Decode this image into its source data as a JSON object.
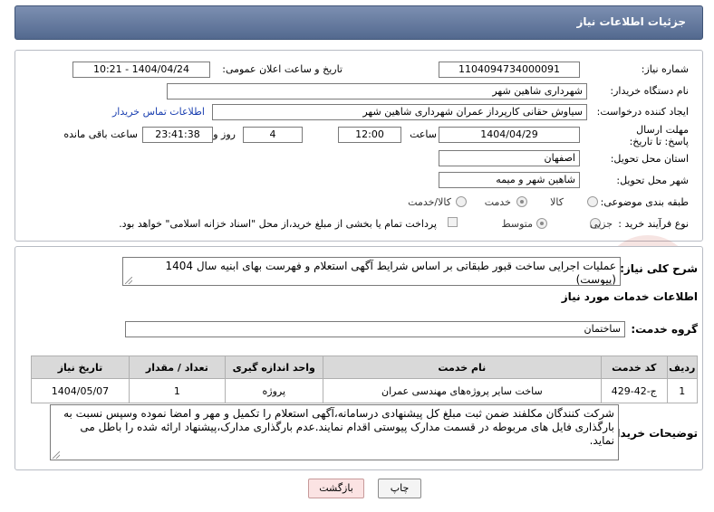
{
  "header": {
    "title": "جزئیات اطلاعات نیاز"
  },
  "fields": {
    "need_number_label": "شماره نیاز:",
    "need_number": "1104094734000091",
    "announce_label": "تاریخ و ساعت اعلان عمومی:",
    "announce_value": "1404/04/24 - 10:21",
    "buyer_label": "نام دستگاه خریدار:",
    "buyer": "شهرداری شاهین شهر",
    "creator_label": "ایجاد کننده درخواست:",
    "creator": "سیاوش حقانی کارپرداز عمران شهرداری شاهین شهر",
    "contact_link": "اطلاعات تماس خریدار",
    "deadline_label": "مهلت ارسال پاسخ: تا تاریخ:",
    "deadline_date": "1404/04/29",
    "time_label": "ساعت",
    "deadline_time": "12:00",
    "days_value": "4",
    "days_label": "روز و",
    "remaining_time": "23:41:38",
    "remaining_label": "ساعت باقی مانده",
    "province_label": "استان محل تحویل:",
    "province": "اصفهان",
    "city_label": "شهر محل تحویل:",
    "city": "شاهین شهر و میمه",
    "category_label": "طبقه بندی موضوعی:",
    "category_options": [
      "کالا",
      "خدمت",
      "کالا/خدمت"
    ],
    "purchase_label": "نوع فرآیند خرید :",
    "purchase_options": [
      "جزیی",
      "متوسط"
    ],
    "payment_note": "پرداخت تمام یا بخشی از مبلغ خرید،از محل \"اسناد خزانه اسلامی\" خواهد بود."
  },
  "summary": {
    "label": "شرح کلی نیاز:",
    "text": "عملیات اجرایی ساخت قبور طبقاتی بر اساس شرایط آگهی استعلام و فهرست بهای ابنیه سال 1404 (پیوست)"
  },
  "services": {
    "section_title": "اطلاعات خدمات مورد نیاز",
    "group_label": "گروه خدمت:",
    "group_value": "ساختمان",
    "columns": [
      "ردیف",
      "کد خدمت",
      "نام خدمت",
      "واحد اندازه گیری",
      "تعداد / مقدار",
      "تاریخ نیاز"
    ],
    "rows": [
      [
        "1",
        "ج-42-429",
        "ساخت سایر پروژه‌های مهندسی عمران",
        "پروژه",
        "1",
        "1404/05/07"
      ]
    ]
  },
  "buyer_notes": {
    "label": "توضیحات خریدار:",
    "text": "شرکت کنندگان مکلفند ضمن ثبت مبلغ کل پیشنهادی درسامانه،آگهی استعلام را  تکمیل و مهر و امضا نموده وسپس نسبت به بارگذاری فایل های مربوطه در قسمت مدارک پیوستی اقدام نمایند.عدم بارگذاری مدارک،پیشنهاد ارائه شده را باطل می نماید."
  },
  "buttons": {
    "print": "چاپ",
    "back": "بازگشت"
  },
  "colors": {
    "header_bg": "#5f7499",
    "link": "#1a3fb0",
    "back_button_bg": "#fbe3e3"
  }
}
